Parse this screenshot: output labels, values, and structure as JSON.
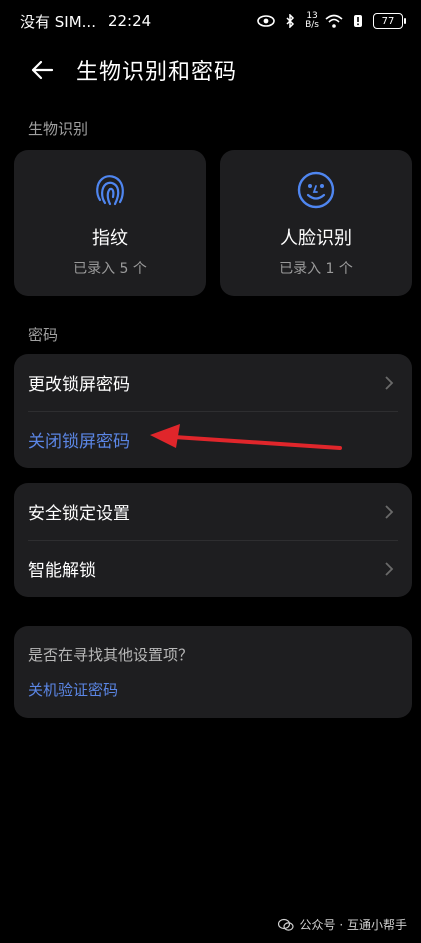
{
  "status": {
    "carrier": "没有 SIM...",
    "time": "22:24",
    "net_speed_value": "13",
    "net_speed_unit": "B/s",
    "battery": "77",
    "icons": [
      "eye-icon",
      "bluetooth-icon",
      "wifi-icon",
      "alert-icon",
      "battery-icon"
    ]
  },
  "header": {
    "title": "生物识别和密码"
  },
  "biometrics": {
    "section_label": "生物识别",
    "fingerprint": {
      "title": "指纹",
      "subtitle": "已录入 5 个",
      "icon": "fingerprint-icon"
    },
    "face": {
      "title": "人脸识别",
      "subtitle": "已录入 1 个",
      "icon": "face-icon"
    }
  },
  "password": {
    "section_label": "密码",
    "change_lock": "更改锁屏密码",
    "close_lock": "关闭锁屏密码"
  },
  "security": {
    "lock_settings": "安全锁定设置",
    "smart_unlock": "智能解锁"
  },
  "suggestion": {
    "question": "是否在寻找其他设置项？",
    "link": "关机验证密码"
  },
  "watermark": "公众号 · 互通小帮手",
  "colors": {
    "accent": "#5b86e5",
    "annotation_arrow": "#e0262b",
    "card_bg": "#1e1e20"
  }
}
